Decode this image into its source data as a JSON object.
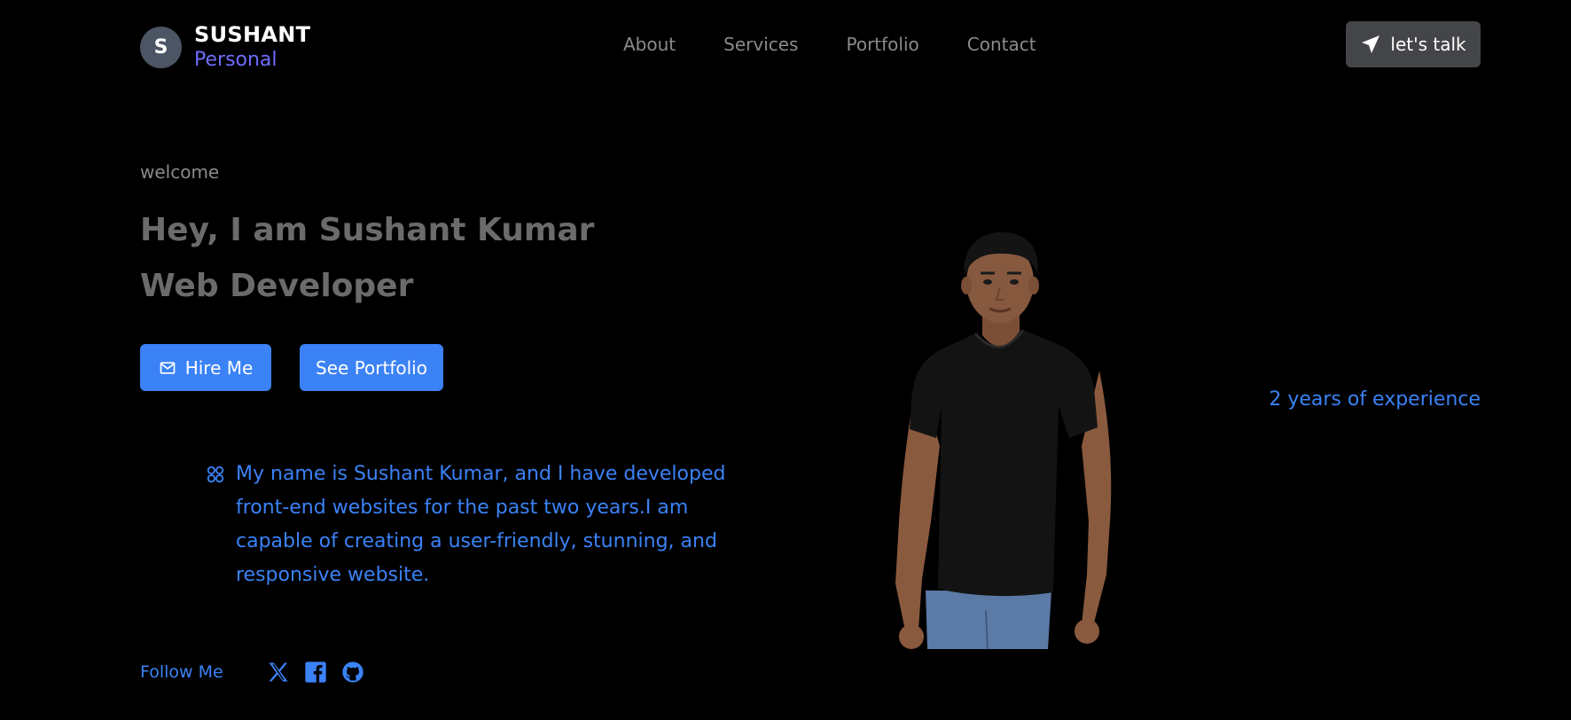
{
  "brand": {
    "initial": "S",
    "name": "SUSHANT",
    "sub": "Personal"
  },
  "nav": {
    "items": [
      "About",
      "Services",
      "Portfolio",
      "Contact"
    ]
  },
  "header": {
    "cta_label": "let's talk"
  },
  "hero": {
    "welcome": "welcome",
    "headline_line1": "Hey, I am Sushant Kumar",
    "headline_line2": "Web Developer",
    "hire_label": "Hire Me",
    "portfolio_label": "See Portfolio",
    "bio": "My name is Sushant Kumar, and I have developed front-end websites for the past two years.I am capable of creating a user-friendly, stunning, and responsive website.",
    "experience": "2 years of experience"
  },
  "follow": {
    "label": "Follow Me",
    "icons": [
      "x-icon",
      "facebook-icon",
      "github-icon"
    ]
  },
  "colors": {
    "accent": "#3b82f6",
    "brand_sub": "#6d6dff",
    "cta_bg": "#444548",
    "background": "#000000"
  }
}
